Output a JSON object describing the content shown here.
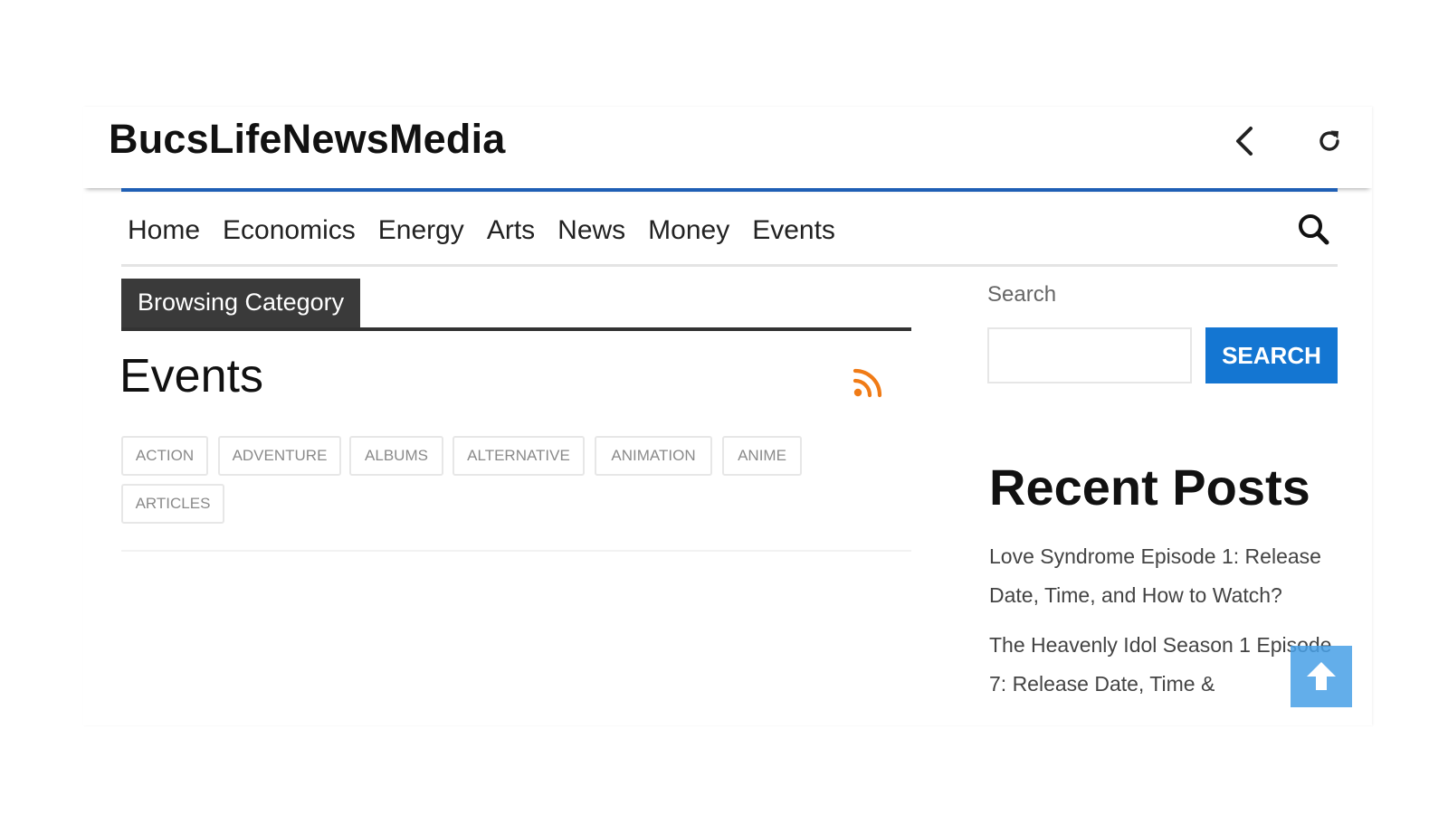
{
  "app": {
    "title": "BucsLifeNewsMedia"
  },
  "toolbar": {
    "back_icon": "chevron-left-icon",
    "reload_icon": "reload-icon"
  },
  "nav": {
    "items": [
      {
        "label": "Home"
      },
      {
        "label": "Economics"
      },
      {
        "label": "Energy"
      },
      {
        "label": "Arts"
      },
      {
        "label": "News"
      },
      {
        "label": "Money"
      },
      {
        "label": "Events"
      }
    ],
    "search_icon": "search-icon"
  },
  "category": {
    "label": "Browsing Category",
    "title": "Events",
    "rss_icon": "rss-icon",
    "tags": [
      "ACTION",
      "ADVENTURE",
      "ALBUMS",
      "ALTERNATIVE",
      "ANIMATION",
      "ANIME",
      "ARTICLES"
    ]
  },
  "sidebar": {
    "search_label": "Search",
    "search_value": "",
    "search_button": "SEARCH",
    "recent_title": "Recent Posts",
    "recent_posts": [
      "Love Syndrome Episode 1: Release Date, Time, and How to Watch?",
      "The Heavenly Idol Season 1 Episode 7: Release Date, Time &"
    ]
  },
  "scroll_top_icon": "arrow-up-icon",
  "colors": {
    "accent_blue": "#1f5fb5",
    "button_blue": "#1476d2",
    "rss_orange": "#f07b16",
    "category_bg": "#3a3a3a",
    "scroll_top_bg": "#48a0e6"
  }
}
